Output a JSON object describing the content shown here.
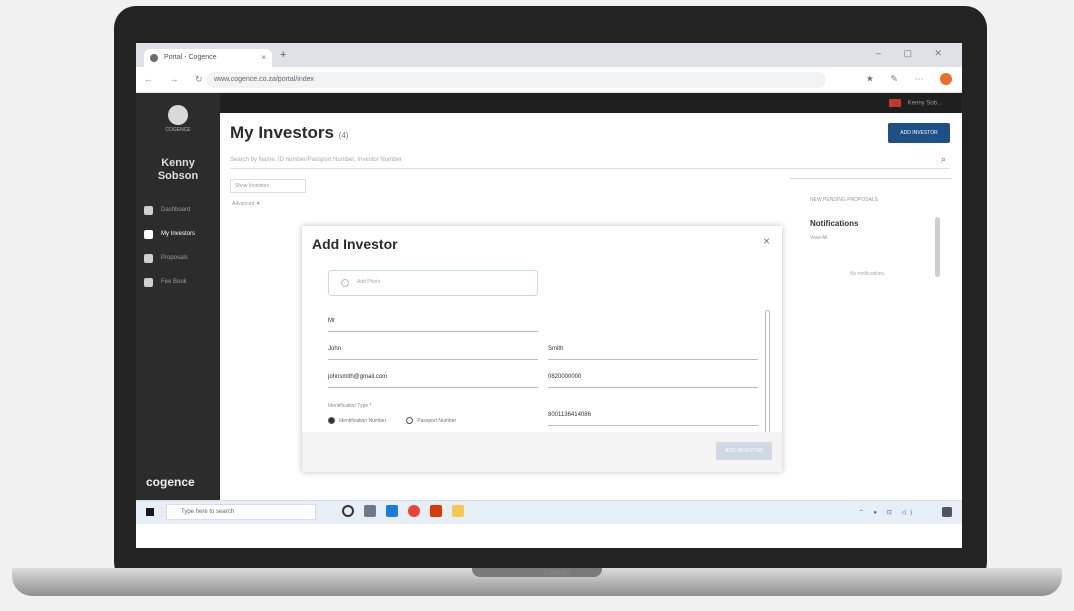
{
  "browser": {
    "tab_title": "Portal - Cogence",
    "new_tab": "+",
    "window_controls": "– ▢ ✕",
    "nav": "← → ↻",
    "url": "www.cogence.co.za/portal/index",
    "extensions": "★ ✎ ⋯"
  },
  "topbar": {
    "user": "Kenny Sob..."
  },
  "sidebar": {
    "user_name": "Kenny Sobson",
    "logo_text": "COGENCE",
    "items": [
      {
        "label": "Dashboard"
      },
      {
        "label": "My Investors"
      },
      {
        "label": "Proposals"
      },
      {
        "label": "Fee Book"
      }
    ],
    "brand": "cogence"
  },
  "page": {
    "title": "My Investors",
    "count": "(4)",
    "add_button": "ADD INVESTOR",
    "search_placeholder": "Search by Name, ID number/Passport Number, Investor Number",
    "list_label": "Show Investors",
    "filter_label": "Advanced ▼"
  },
  "right_panel": {
    "heading": "NEW PENDING PROPOSALS",
    "title": "Notifications",
    "subtitle": "View All",
    "empty": "No notifications"
  },
  "modal": {
    "title": "Add Investor",
    "close": "×",
    "upload_label": "Add Photo",
    "fields": {
      "title": "Mr",
      "first_name": "John",
      "last_name": "Smith",
      "email": "johnsmith@gmail.com",
      "phone": "0820000000",
      "id_number": "8001136414086"
    },
    "id_type_label": "Identification Type *",
    "id_type_options": [
      "Identification Number",
      "Passport Number"
    ],
    "save_label": "ADD INVESTOR"
  },
  "taskbar": {
    "search_placeholder": "Type here to search",
    "tray": "⌃ ● ⊡ ◁)"
  },
  "device_label": "Laptop",
  "colors": {
    "accent": "#1e4f86",
    "sidebar": "#2c2c2c"
  }
}
